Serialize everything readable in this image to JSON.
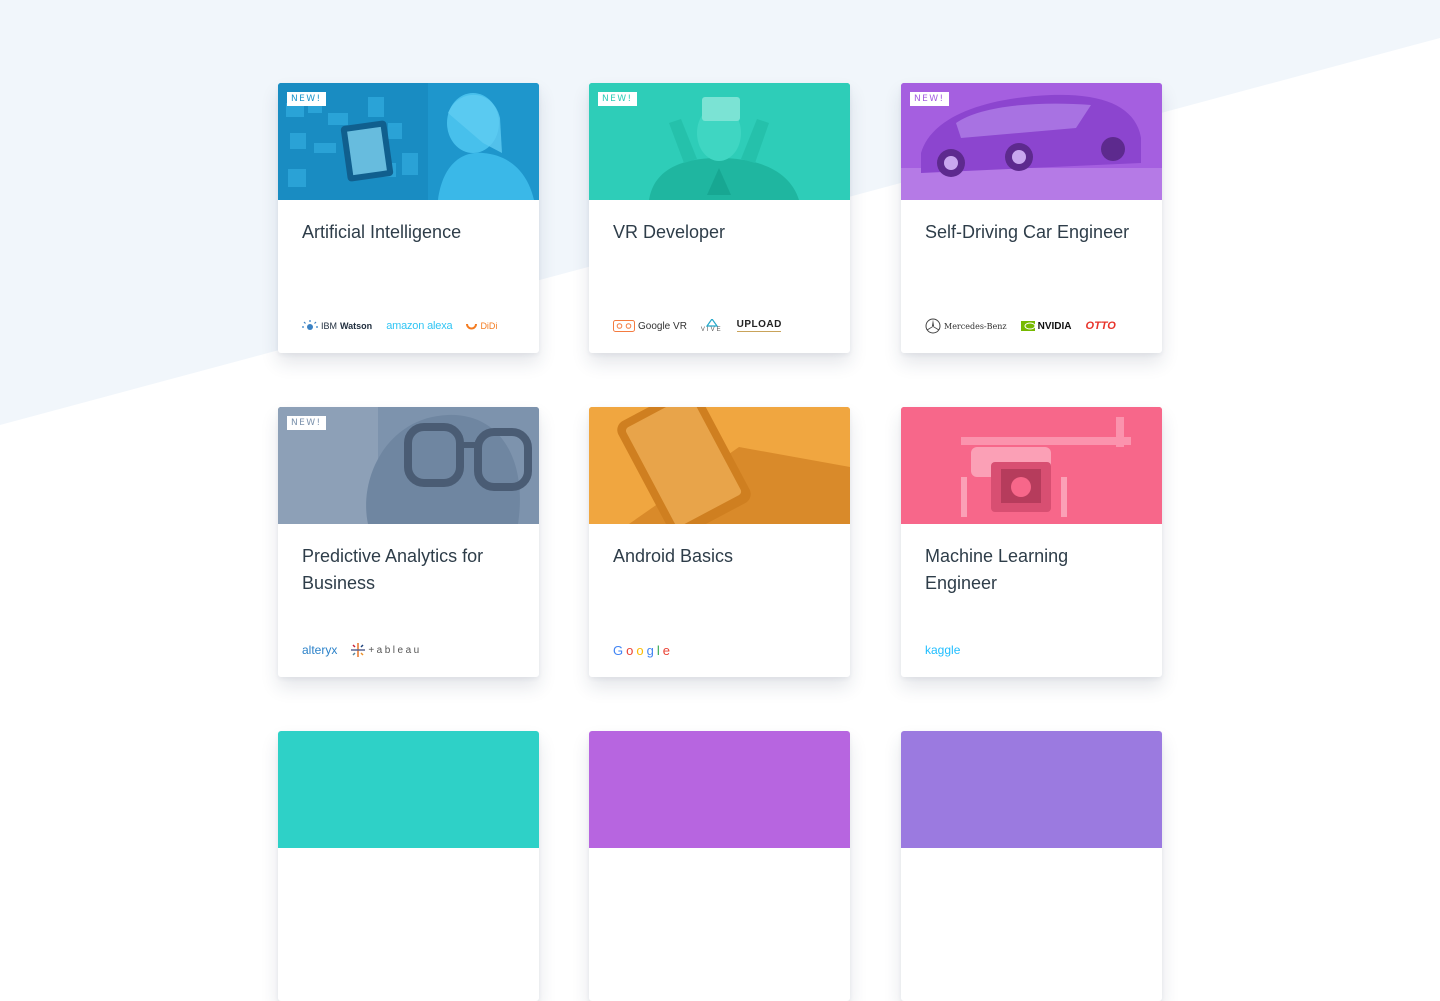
{
  "badge_new": "NEW!",
  "cards": [
    {
      "title": "Artificial Intelligence",
      "new": true,
      "color": "#29a8dc",
      "partners": {
        "watson": [
          "IBM",
          "Watson"
        ],
        "alexa": [
          "amazon",
          "alexa"
        ],
        "didi": "DiDi"
      }
    },
    {
      "title": "VR Developer",
      "new": true,
      "color": "#2ecdb8",
      "partners": {
        "googlevr": "Google VR",
        "vive": "VIVE",
        "upload": "UPLOAD"
      }
    },
    {
      "title": "Self-Driving Car Engineer",
      "new": true,
      "color": "#a55fe0",
      "partners": {
        "mercedes": "Mercedes-Benz",
        "nvidia": "NVIDIA",
        "otto": "OTTO"
      }
    },
    {
      "title": "Predictive Analytics for Business",
      "new": true,
      "color": "#7d93ad",
      "partners": {
        "alteryx": "alteryx",
        "tableau": "+ableau"
      }
    },
    {
      "title": "Android Basics",
      "new": false,
      "color": "#f0a640",
      "partners": {
        "google": [
          "G",
          "o",
          "o",
          "g",
          "l",
          "e"
        ]
      }
    },
    {
      "title": "Machine Learning Engineer",
      "new": false,
      "color": "#f7678a",
      "partners": {
        "kaggle": "kaggle"
      }
    }
  ],
  "next_row_colors": [
    "#2ed1c7",
    "#b765e0",
    "#9b7ae0"
  ],
  "brand_colors": {
    "google": [
      "#4285f4",
      "#ea4335",
      "#fbbc05",
      "#4285f4",
      "#34a853",
      "#ea4335"
    ]
  }
}
